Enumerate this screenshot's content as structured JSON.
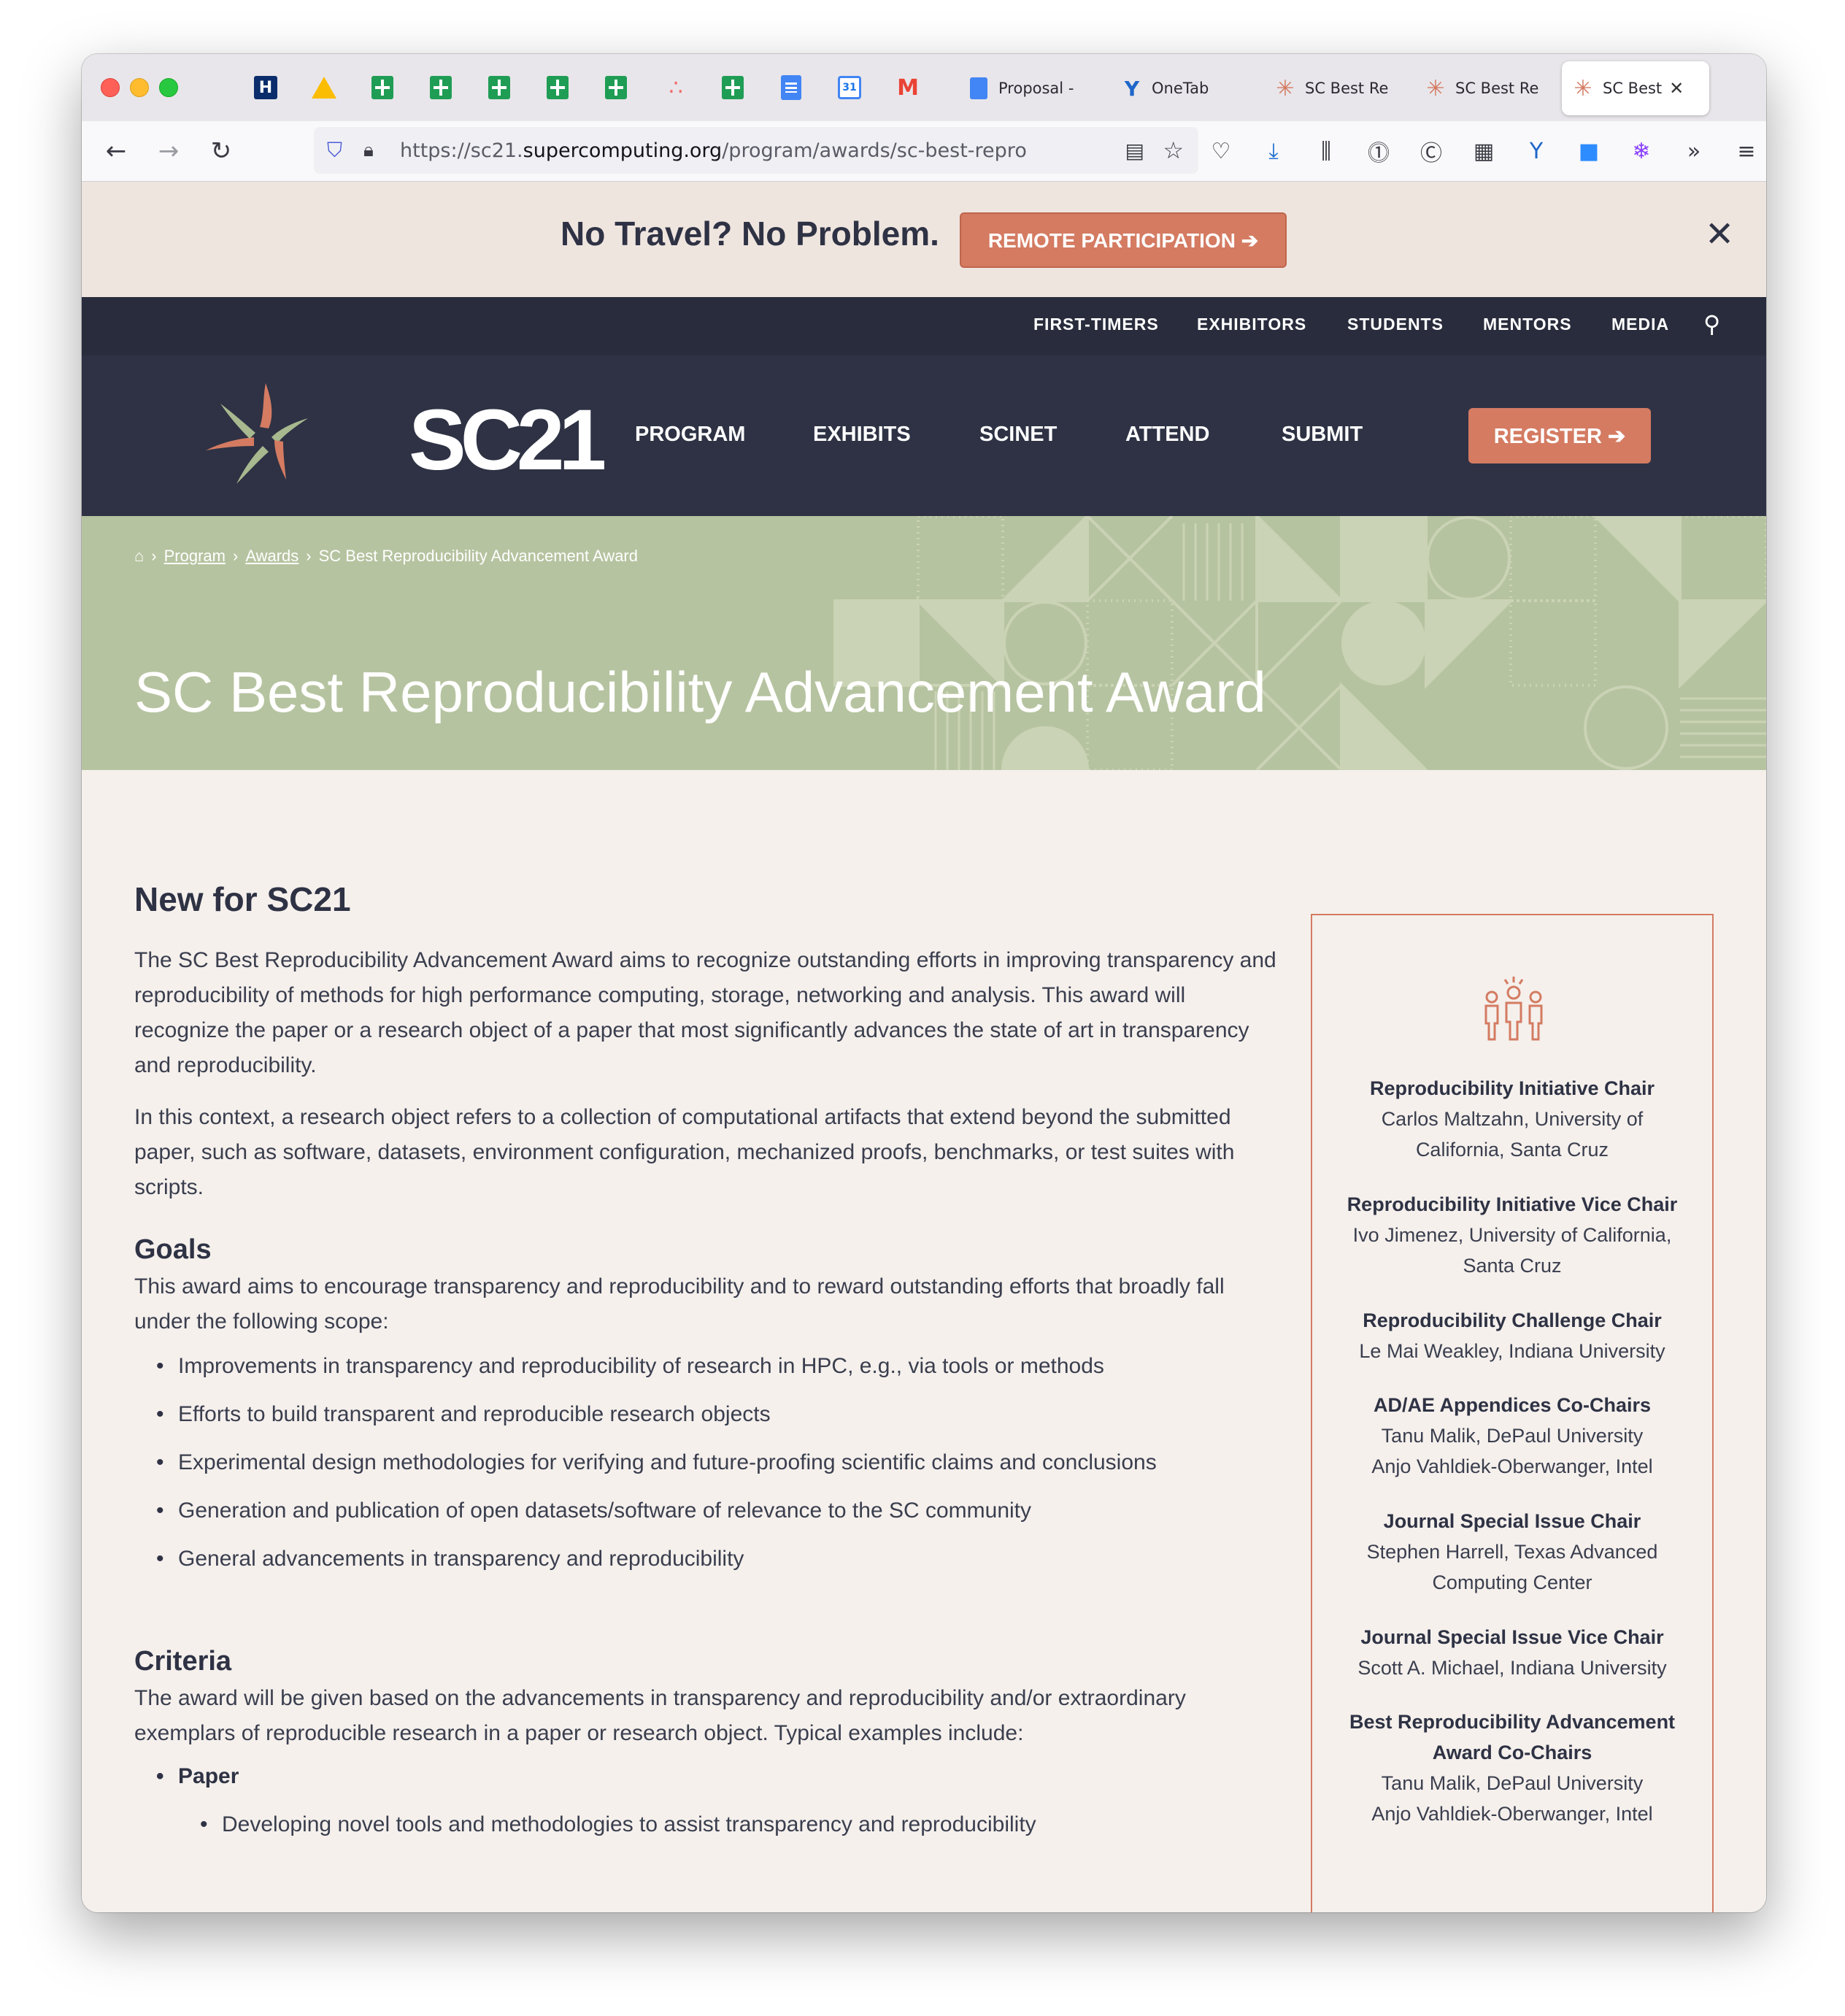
{
  "browser": {
    "tabs": [
      {
        "label": "Proposal - "
      },
      {
        "label": "OneTab"
      },
      {
        "label": "SC Best Re"
      },
      {
        "label": "SC Best Re"
      },
      {
        "label": "SC Best"
      }
    ],
    "url_prefix": "https://sc21.",
    "url_domain": "supercomputing.org",
    "url_path": "/program/awards/sc-best-reprod",
    "calendar_day": "31"
  },
  "promo": {
    "text": "No Travel? No Problem.",
    "button": "REMOTE PARTICIPATION ➔",
    "close": "✕"
  },
  "topnav": {
    "items": [
      "FIRST-TIMERS",
      "EXHIBITORS",
      "STUDENTS",
      "MENTORS",
      "MEDIA"
    ]
  },
  "mainnav": {
    "logo_text": "SC21",
    "items": [
      "PROGRAM",
      "EXHIBITS",
      "SCINET",
      "ATTEND",
      "SUBMIT"
    ],
    "register": "REGISTER ➔"
  },
  "breadcrumb": {
    "items": [
      "Program",
      "Awards"
    ],
    "current": "SC Best Reproducibility Advancement Award"
  },
  "hero": {
    "title": "SC Best Reproducibility Advancement Award"
  },
  "content": {
    "heading": "New for SC21",
    "para1": "The SC Best Reproducibility Advancement Award aims to recognize outstanding efforts in improving transparency and reproducibility of methods for high performance computing, storage, networking and analysis. This award will recognize the paper or a research object of a paper that most significantly advances the state of art in transparency and reproducibility.",
    "para2": "In this context, a research object refers to a collection of computational artifacts that extend beyond the submitted paper, such as software, datasets, environment configuration, mechanized proofs, benchmarks, or test suites with scripts.",
    "goals_heading": "Goals",
    "goals_intro": "This award aims to encourage transparency and reproducibility and to reward outstanding efforts that broadly fall under the following scope:",
    "goals": [
      "Improvements in transparency and reproducibility of research in HPC, e.g., via tools or methods",
      "Efforts to build transparent and reproducible research objects",
      "Experimental design methodologies for verifying and future-proofing scientific claims and conclusions",
      "Generation and publication of open datasets/software of relevance to the SC community",
      "General advancements in transparency and reproducibility"
    ],
    "criteria_heading": "Criteria",
    "criteria_intro": "The award will be given based on the advancements in transparency and reproducibility and/or extraordinary exemplars of reproducible research in a paper or research object. Typical examples include:",
    "criteria_item": "Paper",
    "criteria_sub": "Developing novel tools and methodologies to assist transparency and reproducibility"
  },
  "sidebar": {
    "entries": [
      {
        "role": "Reproducibility Initiative Chair",
        "people": [
          "Carlos Maltzahn, University of",
          "California, Santa Cruz"
        ]
      },
      {
        "role": "Reproducibility Initiative Vice Chair",
        "people": [
          "Ivo Jimenez, University of California,",
          "Santa Cruz"
        ]
      },
      {
        "role": "Reproducibility Challenge Chair",
        "people": [
          "Le Mai Weakley, Indiana University"
        ]
      },
      {
        "role": "AD/AE Appendices Co-Chairs",
        "people": [
          "Tanu Malik, DePaul University",
          "Anjo Vahldiek-Oberwanger, Intel"
        ]
      },
      {
        "role": "Journal Special Issue Chair",
        "people": [
          "Stephen Harrell, Texas Advanced",
          "Computing Center"
        ]
      },
      {
        "role": "Journal Special Issue Vice Chair",
        "people": [
          "Scott A. Michael, Indiana University"
        ]
      },
      {
        "role": "Best Reproducibility Advancement",
        "role2": "Award Co-Chairs",
        "people": [
          "Tanu Malik, DePaul University",
          "Anjo Vahldiek-Oberwanger, Intel"
        ]
      }
    ]
  },
  "colors": {
    "accent": "#d47b62",
    "navy": "#2e3244",
    "sage": "#b6c3a0",
    "page_bg": "#f5f0ec"
  }
}
